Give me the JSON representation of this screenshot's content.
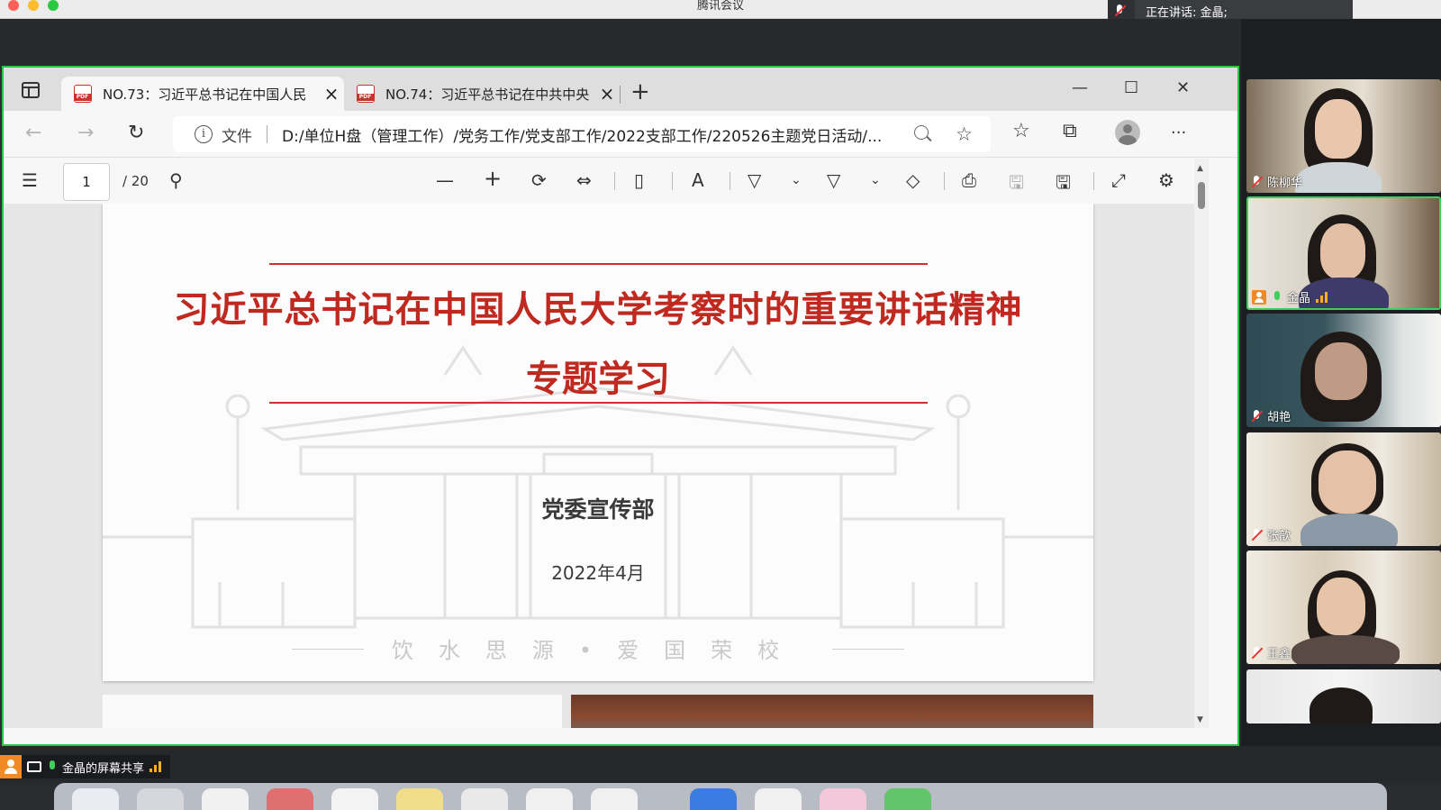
{
  "mac": {
    "title": "腾讯会议"
  },
  "speaking": {
    "label": "正在讲话: 金晶;"
  },
  "browser": {
    "tabs": [
      {
        "title": "NO.73：习近平总书记在中国人民",
        "close": "×"
      },
      {
        "title": "NO.74：习近平总书记在中共中央",
        "close": "×"
      }
    ],
    "new_tab": "+",
    "window": {
      "minimize": "—",
      "maximize": "☐",
      "close": "✕"
    },
    "nav": {
      "back": "←",
      "forward": "→",
      "reload": "↻"
    },
    "omnibox": {
      "info": "i",
      "label": "文件",
      "url": "D:/单位H盘（管理工作）/党务工作/党支部工作/2022支部工作/220526主题党日活动/..."
    },
    "toolbar_icons": {
      "favorite_add": "☆",
      "favorites": "☆",
      "collections": "⧉",
      "more": "···"
    }
  },
  "pdf": {
    "page_current": "1",
    "page_total": "/ 20",
    "buttons": {
      "contents": "☰",
      "search": "⚲",
      "zoom_out": "—",
      "zoom_in": "+",
      "rotate": "⟳",
      "fit": "⇔",
      "page_view": "▯",
      "read_aloud": "A",
      "draw": "▽",
      "draw_menu": "⌄",
      "highlight": "▽",
      "highlight_menu": "⌄",
      "erase": "◇",
      "print": "⎙",
      "save": "🖫",
      "save_as": "🖫",
      "fullscreen": "⤢",
      "settings": "⚙"
    },
    "document": {
      "title_line1": "习近平总书记在中国人民大学考察时的重要讲话精神",
      "title_line2": "专题学习",
      "department": "党委宣传部",
      "date": "2022年4月",
      "motto": "饮水思源•爱国荣校"
    }
  },
  "participants": [
    {
      "name": "陈柳华",
      "muted": true,
      "speaking": false
    },
    {
      "name": "金晶",
      "muted": false,
      "speaking": true,
      "host": true
    },
    {
      "name": "胡艳",
      "muted": true,
      "speaking": false
    },
    {
      "name": "张歆",
      "muted": true,
      "speaking": false
    },
    {
      "name": "王鑫",
      "muted": true,
      "speaking": false
    },
    {
      "name": "",
      "muted": true,
      "speaking": false
    }
  ],
  "share": {
    "label": "金晶的屏幕共享"
  },
  "colors": {
    "accent_green": "#2fc24b",
    "title_red": "#c0291f",
    "host_orange": "#f08a24"
  }
}
